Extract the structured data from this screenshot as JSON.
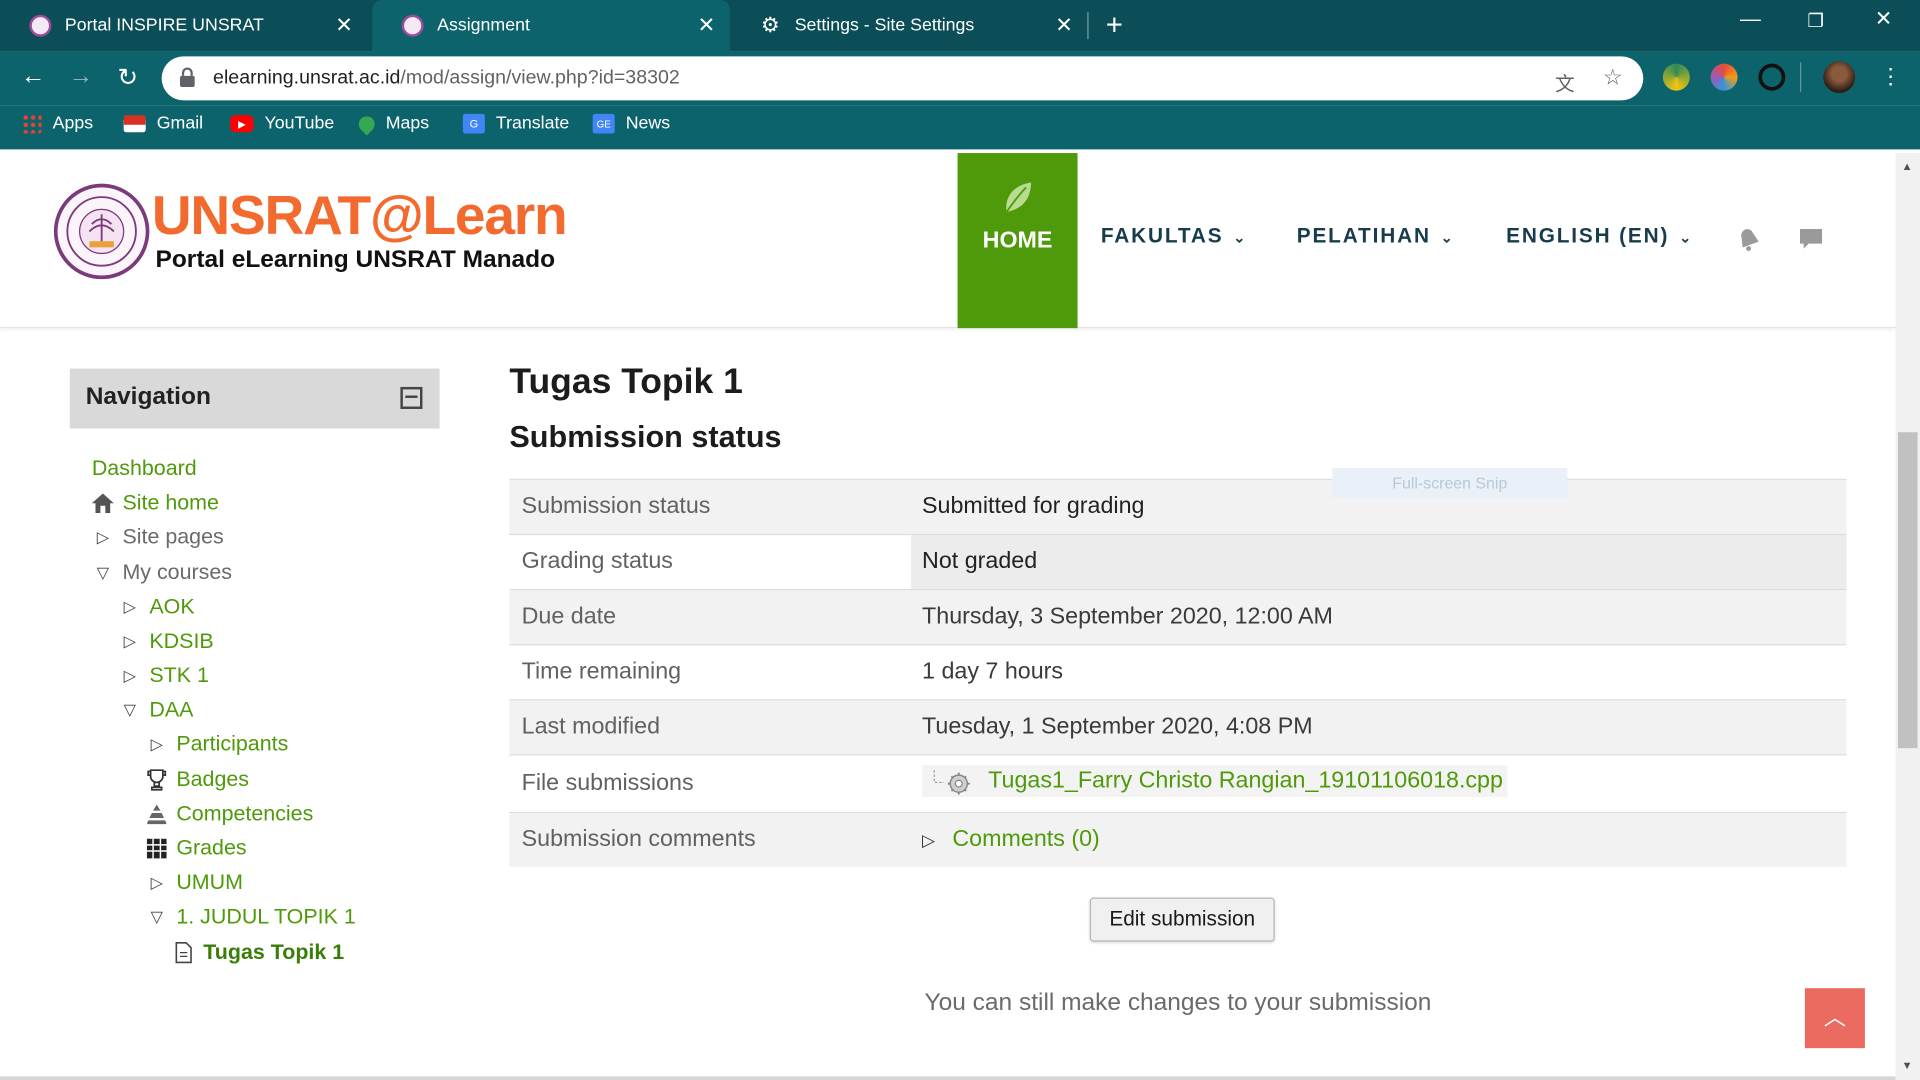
{
  "browser": {
    "tabs": [
      {
        "title": "Portal INSPIRE UNSRAT",
        "active": false
      },
      {
        "title": "Assignment",
        "active": true
      },
      {
        "title": "Settings - Site Settings",
        "active": false
      }
    ],
    "url_host": "elearning.unsrat.ac.id",
    "url_path": "/mod/assign/view.php?id=38302",
    "bookmarks": [
      {
        "label": "Apps",
        "icon": "apps-grid-icon"
      },
      {
        "label": "Gmail",
        "icon": "gmail-icon"
      },
      {
        "label": "YouTube",
        "icon": "youtube-icon"
      },
      {
        "label": "Maps",
        "icon": "maps-icon"
      },
      {
        "label": "Translate",
        "icon": "translate-icon"
      },
      {
        "label": "News",
        "icon": "news-icon"
      }
    ]
  },
  "site": {
    "logo_title": "UNSRAT@Learn",
    "logo_subtitle": "Portal eLearning UNSRAT Manado",
    "nav": {
      "home": "HOME",
      "fakultas": "FAKULTAS",
      "pelatihan": "PELATIHAN",
      "language": "ENGLISH (EN)"
    },
    "brand_colors": {
      "green": "#4f9a0a",
      "orange": "#f26a2e",
      "teal": "#0d636c"
    }
  },
  "navigation": {
    "title": "Navigation",
    "items": [
      {
        "label": "Dashboard"
      },
      {
        "label": "Site home",
        "icon": "house-icon"
      },
      {
        "label": "Site pages",
        "icon": "triangle-right-icon"
      },
      {
        "label": "My courses",
        "icon": "triangle-down-icon"
      },
      {
        "label": "AOK",
        "icon": "triangle-right-icon"
      },
      {
        "label": "KDSIB",
        "icon": "triangle-right-icon"
      },
      {
        "label": "STK 1",
        "icon": "triangle-right-icon"
      },
      {
        "label": "DAA",
        "icon": "triangle-down-icon"
      },
      {
        "label": "Participants",
        "icon": "triangle-right-icon"
      },
      {
        "label": "Badges",
        "icon": "trophy-icon"
      },
      {
        "label": "Competencies",
        "icon": "competencies-icon"
      },
      {
        "label": "Grades",
        "icon": "grid-icon"
      },
      {
        "label": "UMUM",
        "icon": "triangle-right-icon"
      },
      {
        "label": "1. JUDUL TOPIK 1",
        "icon": "triangle-down-icon"
      },
      {
        "label": "Tugas Topik 1",
        "icon": "document-icon"
      }
    ]
  },
  "main": {
    "title": "Tugas Topik 1",
    "section_title": "Submission status",
    "overlay_hint": "Full-screen Snip",
    "rows": [
      {
        "label": "Submission status",
        "value": "Submitted for grading"
      },
      {
        "label": "Grading status",
        "value": "Not graded"
      },
      {
        "label": "Due date",
        "value": "Thursday, 3 September 2020, 12:00 AM"
      },
      {
        "label": "Time remaining",
        "value": "1 day 7 hours"
      },
      {
        "label": "Last modified",
        "value": "Tuesday, 1 September 2020, 4:08 PM"
      },
      {
        "label": "File submissions",
        "value": "Tugas1_Farry Christo Rangian_19101106018.cpp"
      },
      {
        "label": "Submission comments",
        "value": "Comments (0)"
      }
    ],
    "edit_button": "Edit submission",
    "note": "You can still make changes to your submission"
  }
}
